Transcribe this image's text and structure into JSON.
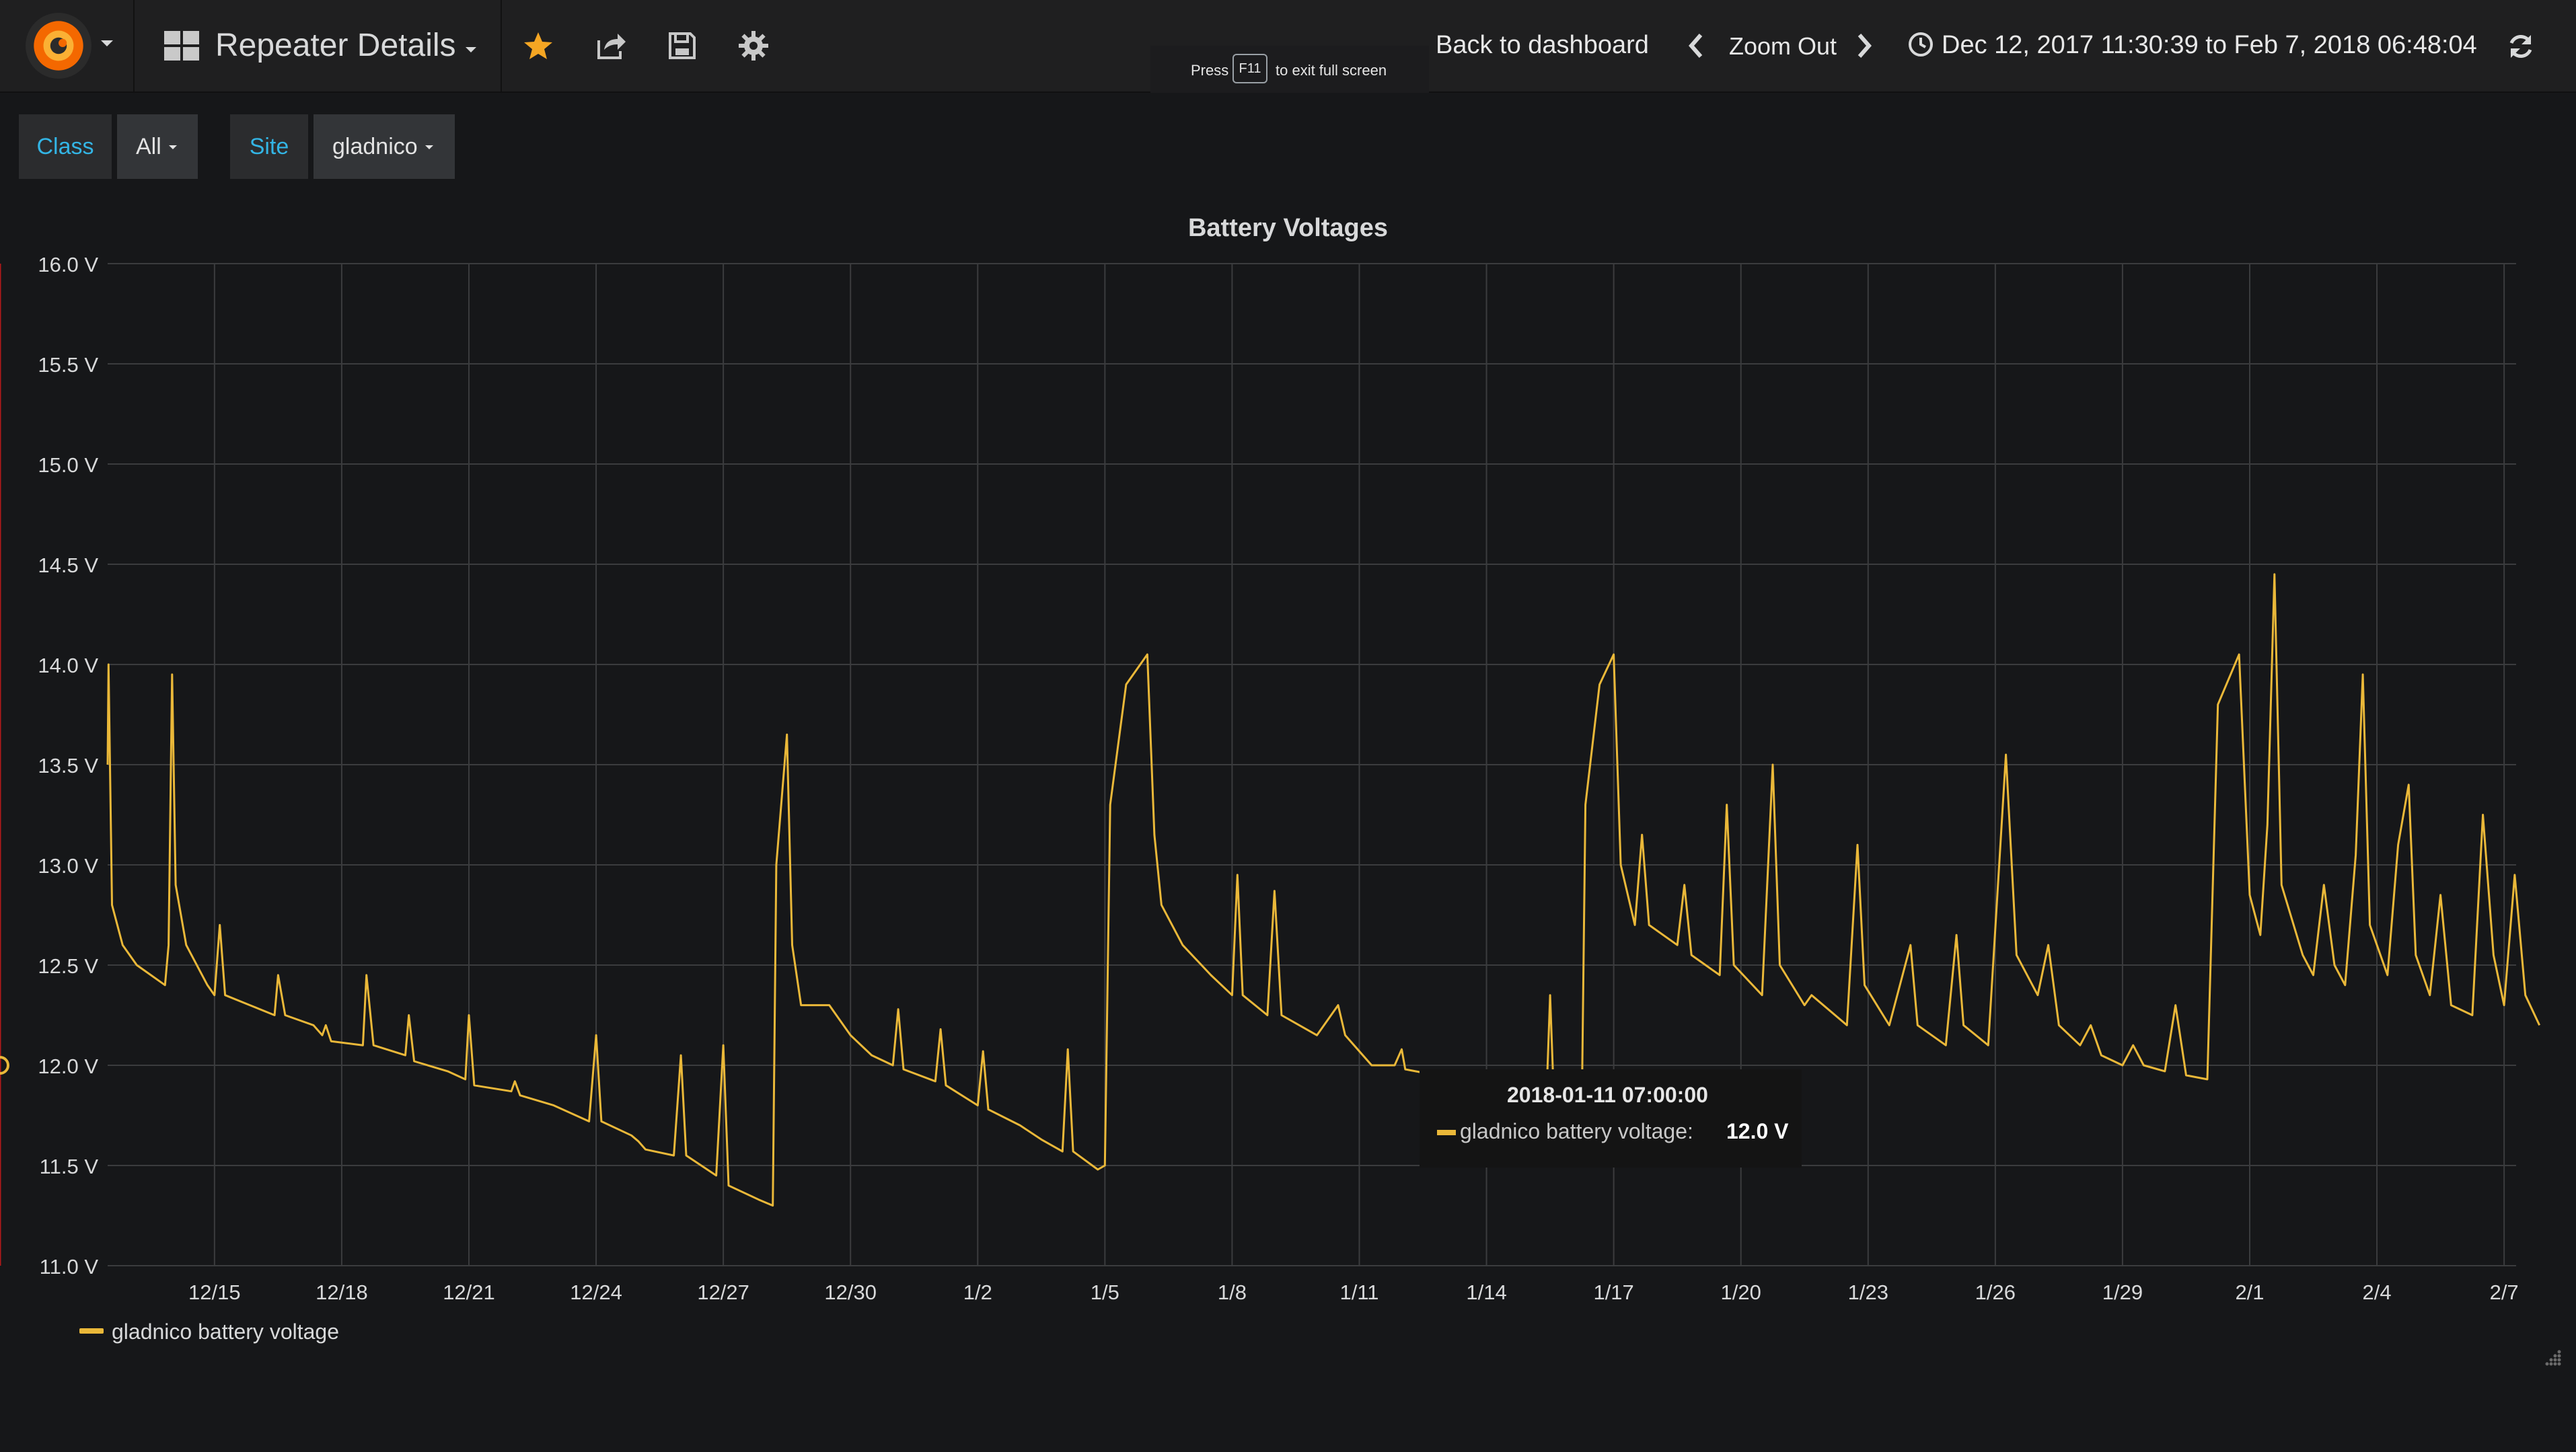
{
  "navbar": {
    "dashboard_title": "Repeater Details",
    "f11_hint": {
      "press": "Press",
      "key": "F11",
      "rest": "to exit full screen"
    },
    "back_to_dashboard": "Back to dashboard",
    "zoom_out": "Zoom Out",
    "time_range": "Dec 12, 2017 11:30:39 to Feb 7, 2018 06:48:04",
    "icons": [
      "grafana-logo-icon",
      "dashboard-grid-icon",
      "star-icon",
      "share-icon",
      "save-icon",
      "gear-icon",
      "chevron-left-icon",
      "chevron-right-icon",
      "clock-icon",
      "refresh-icon"
    ],
    "colors": {
      "star": "#f5a623",
      "accent": "#33b5e5"
    }
  },
  "variables": [
    {
      "label": "Class",
      "value": "All"
    },
    {
      "label": "Site",
      "value": "gladnico"
    }
  ],
  "panel": {
    "title": "Battery Voltages"
  },
  "legend": {
    "series_name": "gladnico battery voltage",
    "color": "#eab839"
  },
  "tooltip": {
    "time": "2018-01-11 07:00:00",
    "series": "gladnico battery voltage:",
    "value": "12.0 V"
  },
  "chart_data": {
    "type": "line",
    "title": "Battery Voltages",
    "ylabel": "",
    "xlabel": "",
    "ylim": [
      11.0,
      16.0
    ],
    "y_ticks": [
      "11.0 V",
      "11.5 V",
      "12.0 V",
      "12.5 V",
      "13.0 V",
      "13.5 V",
      "14.0 V",
      "14.5 V",
      "15.0 V",
      "15.5 V",
      "16.0 V"
    ],
    "x_ticks": [
      "12/15",
      "12/18",
      "12/21",
      "12/24",
      "12/27",
      "12/30",
      "1/2",
      "1/5",
      "1/8",
      "1/11",
      "1/14",
      "1/17",
      "1/20",
      "1/23",
      "1/26",
      "1/29",
      "2/1",
      "2/4",
      "2/7"
    ],
    "grid": true,
    "legend_position": "bottom-left",
    "crosshair_x": "2018-01-11 07:00:00",
    "series": [
      {
        "name": "gladnico battery voltage",
        "color": "#eab839",
        "points": [
          [
            "2017-12-12 11:30",
            13.5
          ],
          [
            "2017-12-12 12:00",
            14.0
          ],
          [
            "2017-12-12 14:00",
            12.8
          ],
          [
            "2017-12-12 20:00",
            12.6
          ],
          [
            "2017-12-13 04:00",
            12.5
          ],
          [
            "2017-12-13 12:00",
            12.45
          ],
          [
            "2017-12-13 20:00",
            12.4
          ],
          [
            "2017-12-13 22:00",
            12.6
          ],
          [
            "2017-12-14 00:00",
            13.95
          ],
          [
            "2017-12-14 02:00",
            12.9
          ],
          [
            "2017-12-14 08:00",
            12.6
          ],
          [
            "2017-12-14 20:00",
            12.4
          ],
          [
            "2017-12-15 00:00",
            12.35
          ],
          [
            "2017-12-15 03:00",
            12.7
          ],
          [
            "2017-12-15 06:00",
            12.35
          ],
          [
            "2017-12-15 20:00",
            12.3
          ],
          [
            "2017-12-16 10:00",
            12.25
          ],
          [
            "2017-12-16 12:00",
            12.45
          ],
          [
            "2017-12-16 16:00",
            12.25
          ],
          [
            "2017-12-17 08:00",
            12.2
          ],
          [
            "2017-12-17 13:00",
            12.15
          ],
          [
            "2017-12-17 15:00",
            12.2
          ],
          [
            "2017-12-17 18:00",
            12.12
          ],
          [
            "2017-12-18 12:00",
            12.1
          ],
          [
            "2017-12-18 14:00",
            12.45
          ],
          [
            "2017-12-18 18:00",
            12.1
          ],
          [
            "2017-12-19 12:00",
            12.05
          ],
          [
            "2017-12-19 14:00",
            12.25
          ],
          [
            "2017-12-19 17:00",
            12.02
          ],
          [
            "2017-12-20 12:00",
            11.97
          ],
          [
            "2017-12-20 22:00",
            11.93
          ],
          [
            "2017-12-21 00:00",
            12.25
          ],
          [
            "2017-12-21 03:00",
            11.9
          ],
          [
            "2017-12-22 00:00",
            11.87
          ],
          [
            "2017-12-22 02:00",
            11.92
          ],
          [
            "2017-12-22 05:00",
            11.85
          ],
          [
            "2017-12-23 00:00",
            11.8
          ],
          [
            "2017-12-23 20:00",
            11.72
          ],
          [
            "2017-12-24 00:00",
            12.15
          ],
          [
            "2017-12-24 03:00",
            11.72
          ],
          [
            "2017-12-24 20:00",
            11.65
          ],
          [
            "2017-12-25 00:00",
            11.62
          ],
          [
            "2017-12-25 04:00",
            11.58
          ],
          [
            "2017-12-25 20:00",
            11.55
          ],
          [
            "2017-12-26 00:00",
            12.05
          ],
          [
            "2017-12-26 03:00",
            11.55
          ],
          [
            "2017-12-26 20:00",
            11.45
          ],
          [
            "2017-12-27 00:00",
            12.1
          ],
          [
            "2017-12-27 03:00",
            11.4
          ],
          [
            "2017-12-27 20:00",
            11.33
          ],
          [
            "2017-12-28 04:00",
            11.3
          ],
          [
            "2017-12-28 06:00",
            13.0
          ],
          [
            "2017-12-28 12:00",
            13.65
          ],
          [
            "2017-12-28 15:00",
            12.6
          ],
          [
            "2017-12-28 20:00",
            12.3
          ],
          [
            "2017-12-29 12:00",
            12.3
          ],
          [
            "2017-12-30 00:00",
            12.15
          ],
          [
            "2017-12-30 12:00",
            12.05
          ],
          [
            "2017-12-31 00:00",
            12.0
          ],
          [
            "2017-12-31 03:00",
            12.28
          ],
          [
            "2017-12-31 06:00",
            11.98
          ],
          [
            "2018-01-01 00:00",
            11.92
          ],
          [
            "2018-01-01 03:00",
            12.18
          ],
          [
            "2018-01-01 06:00",
            11.9
          ],
          [
            "2018-01-02 00:00",
            11.8
          ],
          [
            "2018-01-02 03:00",
            12.07
          ],
          [
            "2018-01-02 06:00",
            11.78
          ],
          [
            "2018-01-03 00:00",
            11.7
          ],
          [
            "2018-01-03 12:00",
            11.63
          ],
          [
            "2018-01-04 00:00",
            11.57
          ],
          [
            "2018-01-04 03:00",
            12.08
          ],
          [
            "2018-01-04 06:00",
            11.57
          ],
          [
            "2018-01-04 20:00",
            11.48
          ],
          [
            "2018-01-05 00:00",
            11.5
          ],
          [
            "2018-01-05 03:00",
            13.3
          ],
          [
            "2018-01-05 12:00",
            13.9
          ],
          [
            "2018-01-06 00:00",
            14.05
          ],
          [
            "2018-01-06 04:00",
            13.15
          ],
          [
            "2018-01-06 08:00",
            12.8
          ],
          [
            "2018-01-06 20:00",
            12.6
          ],
          [
            "2018-01-07 12:00",
            12.45
          ],
          [
            "2018-01-08 00:00",
            12.35
          ],
          [
            "2018-01-08 03:00",
            12.95
          ],
          [
            "2018-01-08 06:00",
            12.35
          ],
          [
            "2018-01-08 20:00",
            12.25
          ],
          [
            "2018-01-09 00:00",
            12.87
          ],
          [
            "2018-01-09 04:00",
            12.25
          ],
          [
            "2018-01-10 00:00",
            12.15
          ],
          [
            "2018-01-10 12:00",
            12.3
          ],
          [
            "2018-01-10 16:00",
            12.15
          ],
          [
            "2018-01-11 07:00",
            12.0
          ],
          [
            "2018-01-11 20:00",
            12.0
          ],
          [
            "2018-01-12 00:00",
            12.08
          ],
          [
            "2018-01-12 02:00",
            11.98
          ],
          [
            "2018-01-12 20:00",
            11.95
          ],
          [
            "2018-01-13 06:00",
            11.92
          ],
          [
            "2018-01-14 18:00",
            11.88
          ],
          [
            "2018-01-15 10:00",
            11.85
          ],
          [
            "2018-01-15 12:00",
            12.35
          ],
          [
            "2018-01-15 14:00",
            11.86
          ],
          [
            "2018-01-16 06:00",
            11.84
          ],
          [
            "2018-01-16 08:00",
            13.3
          ],
          [
            "2018-01-16 16:00",
            13.9
          ],
          [
            "2018-01-17 00:00",
            14.05
          ],
          [
            "2018-01-17 04:00",
            13.0
          ],
          [
            "2018-01-17 12:00",
            12.7
          ],
          [
            "2018-01-17 16:00",
            13.15
          ],
          [
            "2018-01-17 20:00",
            12.7
          ],
          [
            "2018-01-18 12:00",
            12.6
          ],
          [
            "2018-01-18 16:00",
            12.9
          ],
          [
            "2018-01-18 20:00",
            12.55
          ],
          [
            "2018-01-19 12:00",
            12.45
          ],
          [
            "2018-01-19 16:00",
            13.3
          ],
          [
            "2018-01-19 20:00",
            12.5
          ],
          [
            "2018-01-20 12:00",
            12.35
          ],
          [
            "2018-01-20 18:00",
            13.5
          ],
          [
            "2018-01-20 22:00",
            12.5
          ],
          [
            "2018-01-21 12:00",
            12.3
          ],
          [
            "2018-01-21 16:00",
            12.35
          ],
          [
            "2018-01-22 12:00",
            12.2
          ],
          [
            "2018-01-22 18:00",
            13.1
          ],
          [
            "2018-01-22 22:00",
            12.4
          ],
          [
            "2018-01-23 12:00",
            12.2
          ],
          [
            "2018-01-24 00:00",
            12.6
          ],
          [
            "2018-01-24 04:00",
            12.2
          ],
          [
            "2018-01-24 20:00",
            12.1
          ],
          [
            "2018-01-25 02:00",
            12.65
          ],
          [
            "2018-01-25 06:00",
            12.2
          ],
          [
            "2018-01-25 20:00",
            12.1
          ],
          [
            "2018-01-26 06:00",
            13.55
          ],
          [
            "2018-01-26 12:00",
            12.55
          ],
          [
            "2018-01-27 00:00",
            12.35
          ],
          [
            "2018-01-27 06:00",
            12.6
          ],
          [
            "2018-01-27 12:00",
            12.2
          ],
          [
            "2018-01-28 00:00",
            12.1
          ],
          [
            "2018-01-28 06:00",
            12.2
          ],
          [
            "2018-01-28 12:00",
            12.05
          ],
          [
            "2018-01-29 00:00",
            12.0
          ],
          [
            "2018-01-29 06:00",
            12.1
          ],
          [
            "2018-01-29 12:00",
            12.0
          ],
          [
            "2018-01-30 00:00",
            11.97
          ],
          [
            "2018-01-30 06:00",
            12.3
          ],
          [
            "2018-01-30 12:00",
            11.95
          ],
          [
            "2018-01-31 00:00",
            11.93
          ],
          [
            "2018-01-31 06:00",
            13.8
          ],
          [
            "2018-01-31 18:00",
            14.05
          ],
          [
            "2018-02-01 00:00",
            12.85
          ],
          [
            "2018-02-01 06:00",
            12.65
          ],
          [
            "2018-02-01 10:00",
            13.2
          ],
          [
            "2018-02-01 14:00",
            14.45
          ],
          [
            "2018-02-01 18:00",
            12.9
          ],
          [
            "2018-02-02 06:00",
            12.55
          ],
          [
            "2018-02-02 12:00",
            12.45
          ],
          [
            "2018-02-02 18:00",
            12.9
          ],
          [
            "2018-02-03 00:00",
            12.5
          ],
          [
            "2018-02-03 06:00",
            12.4
          ],
          [
            "2018-02-03 12:00",
            13.05
          ],
          [
            "2018-02-03 16:00",
            13.95
          ],
          [
            "2018-02-03 20:00",
            12.7
          ],
          [
            "2018-02-04 06:00",
            12.45
          ],
          [
            "2018-02-04 12:00",
            13.1
          ],
          [
            "2018-02-04 18:00",
            13.4
          ],
          [
            "2018-02-04 22:00",
            12.55
          ],
          [
            "2018-02-05 06:00",
            12.35
          ],
          [
            "2018-02-05 12:00",
            12.85
          ],
          [
            "2018-02-05 18:00",
            12.3
          ],
          [
            "2018-02-06 06:00",
            12.25
          ],
          [
            "2018-02-06 12:00",
            13.25
          ],
          [
            "2018-02-06 18:00",
            12.55
          ],
          [
            "2018-02-07 00:00",
            12.3
          ],
          [
            "2018-02-07 06:00",
            12.95
          ],
          [
            "2018-02-07 12:00",
            12.35
          ],
          [
            "2018-02-07 20:00",
            12.2
          ]
        ]
      }
    ]
  }
}
